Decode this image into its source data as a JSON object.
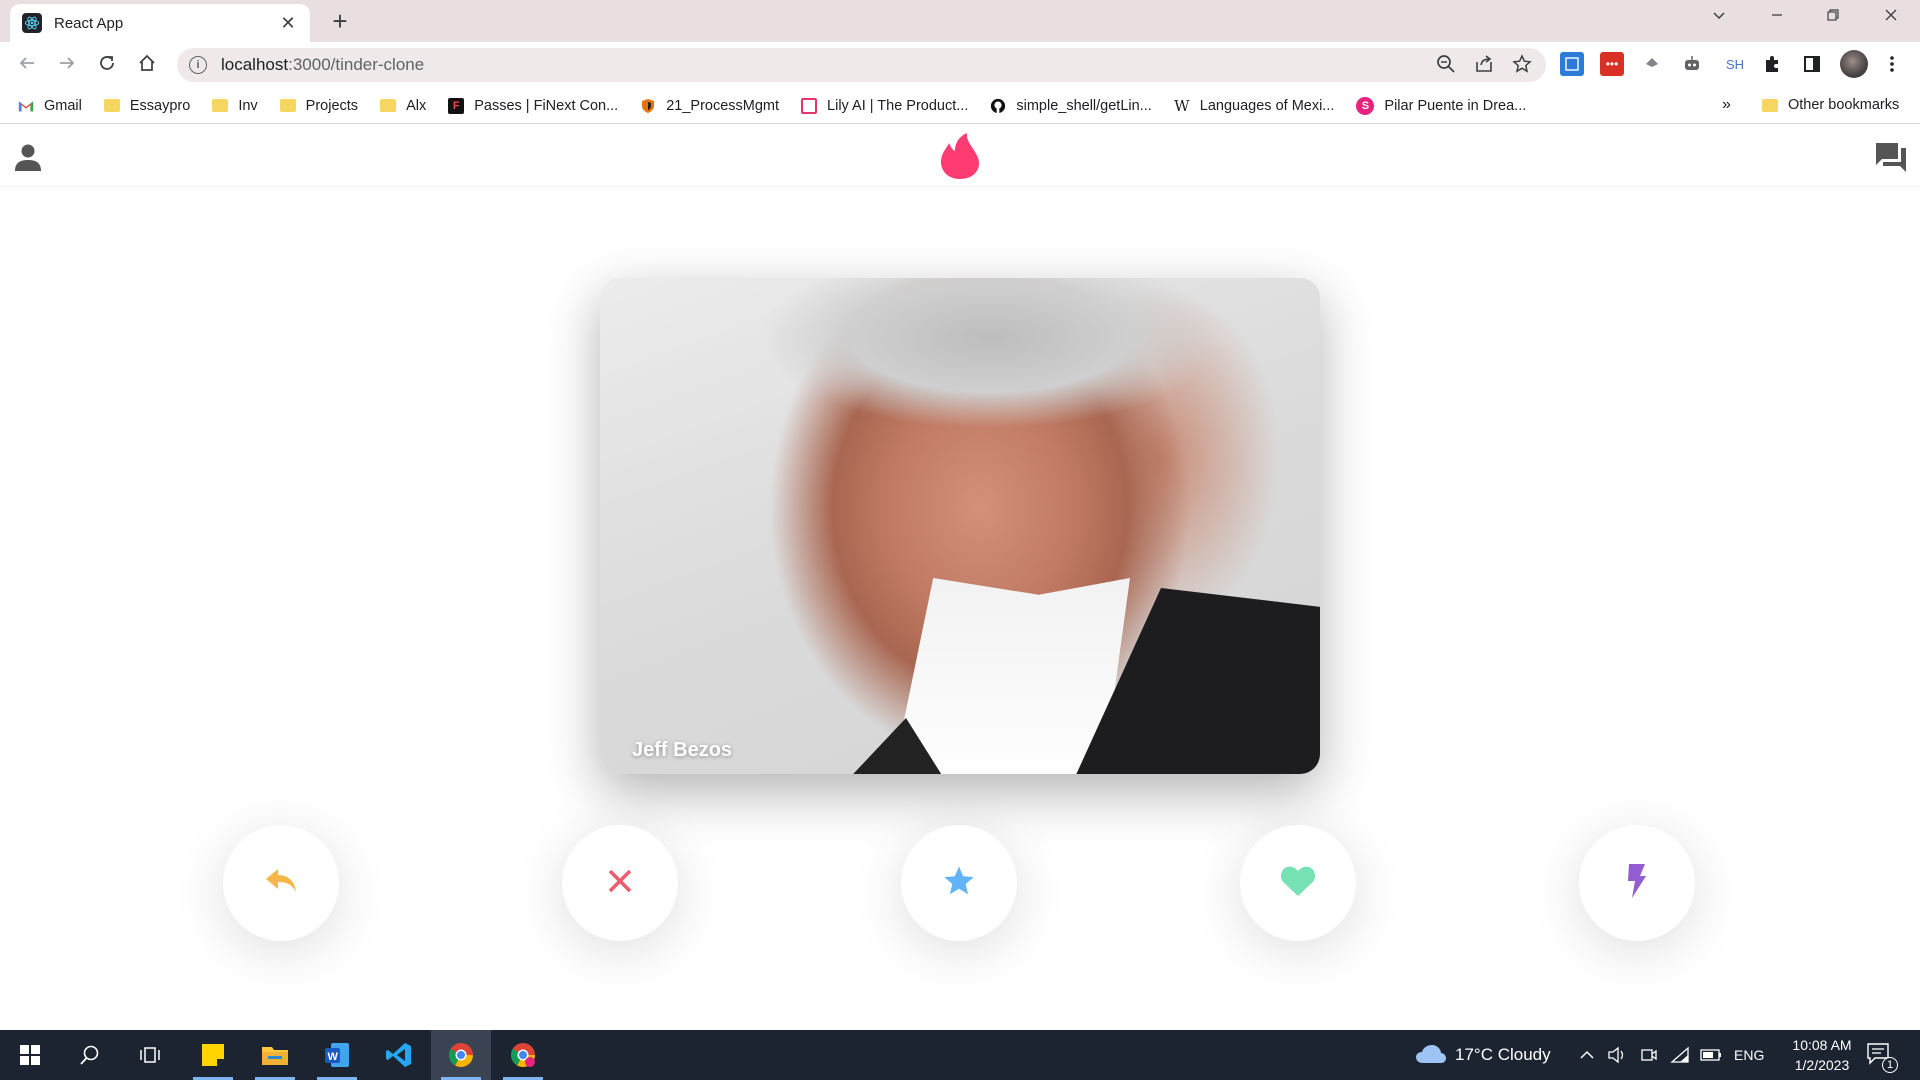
{
  "browser": {
    "tab_title": "React App",
    "url_host": "localhost",
    "url_path": ":3000/tinder-clone",
    "extension_sh_label": "SH",
    "colors": {
      "tabstrip": "#e9dfe0",
      "omnibox": "#efe9ea"
    }
  },
  "bookmarks": {
    "items": [
      {
        "label": "Gmail",
        "icon": "gmail-icon"
      },
      {
        "label": "Essaypro",
        "icon": "folder-icon"
      },
      {
        "label": "Inv",
        "icon": "folder-icon"
      },
      {
        "label": "Projects",
        "icon": "folder-icon"
      },
      {
        "label": "Alx",
        "icon": "folder-icon"
      },
      {
        "label": "Passes | FiNext Con...",
        "icon": "finext-icon"
      },
      {
        "label": "21_ProcessMgmt",
        "icon": "shield-icon"
      },
      {
        "label": "Lily AI | The Product...",
        "icon": "lily-icon"
      },
      {
        "label": "simple_shell/getLin...",
        "icon": "github-icon"
      },
      {
        "label": "Languages of Mexi...",
        "icon": "wikipedia-icon"
      },
      {
        "label": "Pilar Puente in Drea...",
        "icon": "s-circle-icon"
      }
    ],
    "more": "»",
    "other": "Other bookmarks"
  },
  "app": {
    "header": {
      "left_icon": "person-icon",
      "logo_icon": "flame-icon",
      "right_icon": "forum-icon"
    },
    "card": {
      "name": "Jeff Bezos"
    },
    "buttons": [
      {
        "name": "replay-button",
        "icon": "replay-icon",
        "color": "#f5b748"
      },
      {
        "name": "nope-button",
        "icon": "close-icon",
        "color": "#ec5e6f"
      },
      {
        "name": "super-like-button",
        "icon": "star-icon",
        "color": "#62b4f9"
      },
      {
        "name": "like-button",
        "icon": "heart-icon",
        "color": "#76e2b3"
      },
      {
        "name": "boost-button",
        "icon": "flash-icon",
        "color": "#915dd1"
      }
    ],
    "colors": {
      "logo": "#fe3c72"
    }
  },
  "taskbar": {
    "weather": "17°C  Cloudy",
    "language": "ENG",
    "time": "10:08 AM",
    "date": "1/2/2023",
    "notification_count": "1"
  }
}
